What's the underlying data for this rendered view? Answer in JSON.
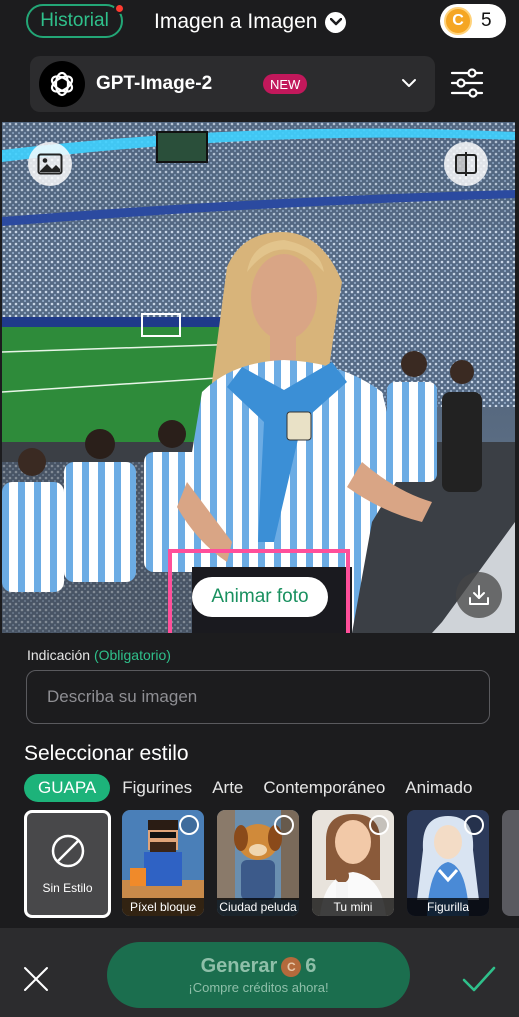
{
  "header": {
    "history_label": "Historial",
    "title": "Imagen a Imagen",
    "credits": "5",
    "coin_symbol": "C"
  },
  "model": {
    "name": "GPT-Image-2",
    "badge": "NEW"
  },
  "photo": {
    "animate_label": "Animar foto",
    "highlight_color": "#ff4f9a"
  },
  "prompt": {
    "label": "Indicación",
    "required": "(Obligatorio)",
    "placeholder": "Describa su imagen",
    "value": ""
  },
  "styles": {
    "title": "Seleccionar estilo",
    "tabs": [
      "GUAPA",
      "Figurines",
      "Arte",
      "Contemporáneo",
      "Animado"
    ],
    "active_tab": "GUAPA",
    "cards": [
      {
        "label": "Sin Estilo",
        "selected": true
      },
      {
        "label": "Píxel bloque",
        "selected": false
      },
      {
        "label": "Ciudad peluda",
        "selected": false
      },
      {
        "label": "Tu mini",
        "selected": false
      },
      {
        "label": "Figurilla",
        "selected": false
      }
    ]
  },
  "footer": {
    "generate_label": "Generar",
    "generate_cost": "6",
    "generate_sub": "¡Compre créditos ahora!",
    "coin_symbol": "C"
  },
  "colors": {
    "accent": "#1db37a",
    "background": "#1c1c1e",
    "badge": "#c2185b"
  },
  "icons": [
    "history-dot",
    "chevron-down-icon",
    "coin-icon",
    "openai-logo-icon",
    "sliders-icon",
    "image-icon",
    "compare-icon",
    "download-icon",
    "no-style-icon",
    "close-icon",
    "checkmark-icon"
  ]
}
